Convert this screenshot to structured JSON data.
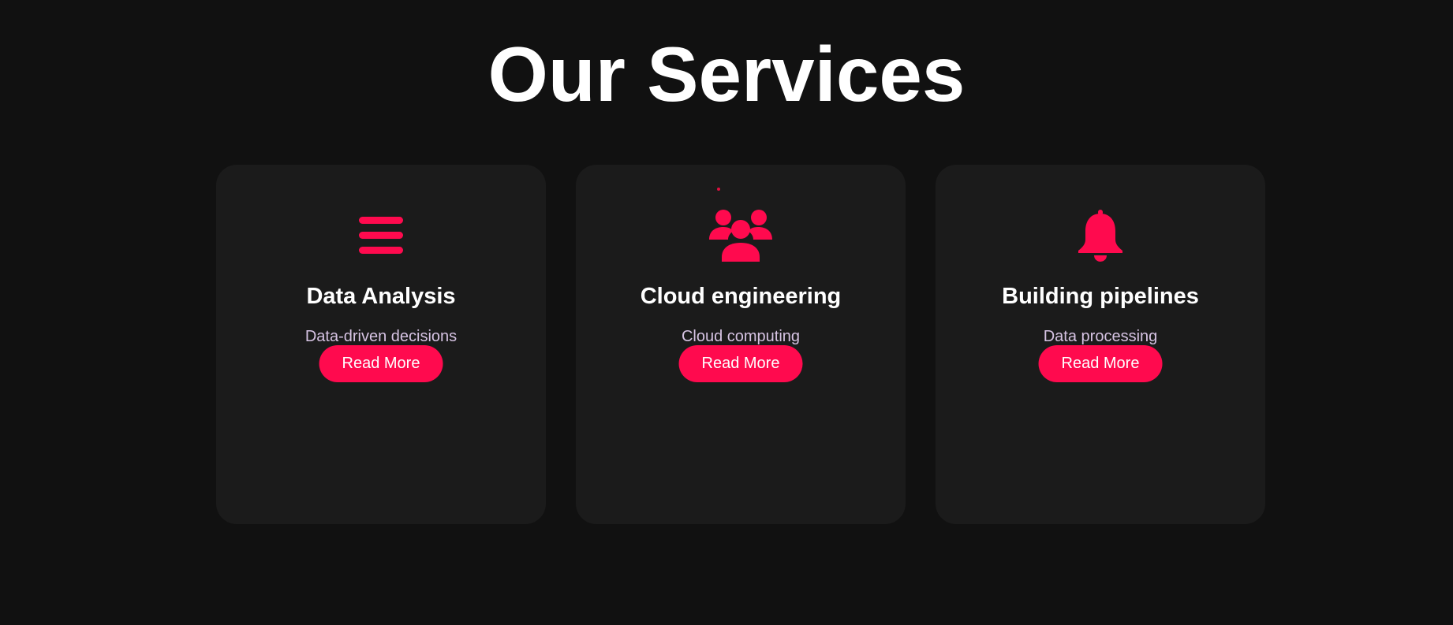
{
  "page": {
    "title": "Our Services"
  },
  "theme": {
    "background": "#111111",
    "card_background": "#1b1b1b",
    "accent": "#ff0a4e",
    "title_color": "#ffffff",
    "description_color": "#d6c3e3"
  },
  "services": [
    {
      "icon": "menu-bars-icon",
      "title": "Data Analysis",
      "description": "Data-driven decisions",
      "button_label": "Read More"
    },
    {
      "icon": "users-group-icon",
      "title": "Cloud engineering",
      "description": "Cloud computing",
      "button_label": "Read More"
    },
    {
      "icon": "bell-icon",
      "title": "Building pipelines",
      "description": "Data processing",
      "button_label": "Read More"
    }
  ]
}
